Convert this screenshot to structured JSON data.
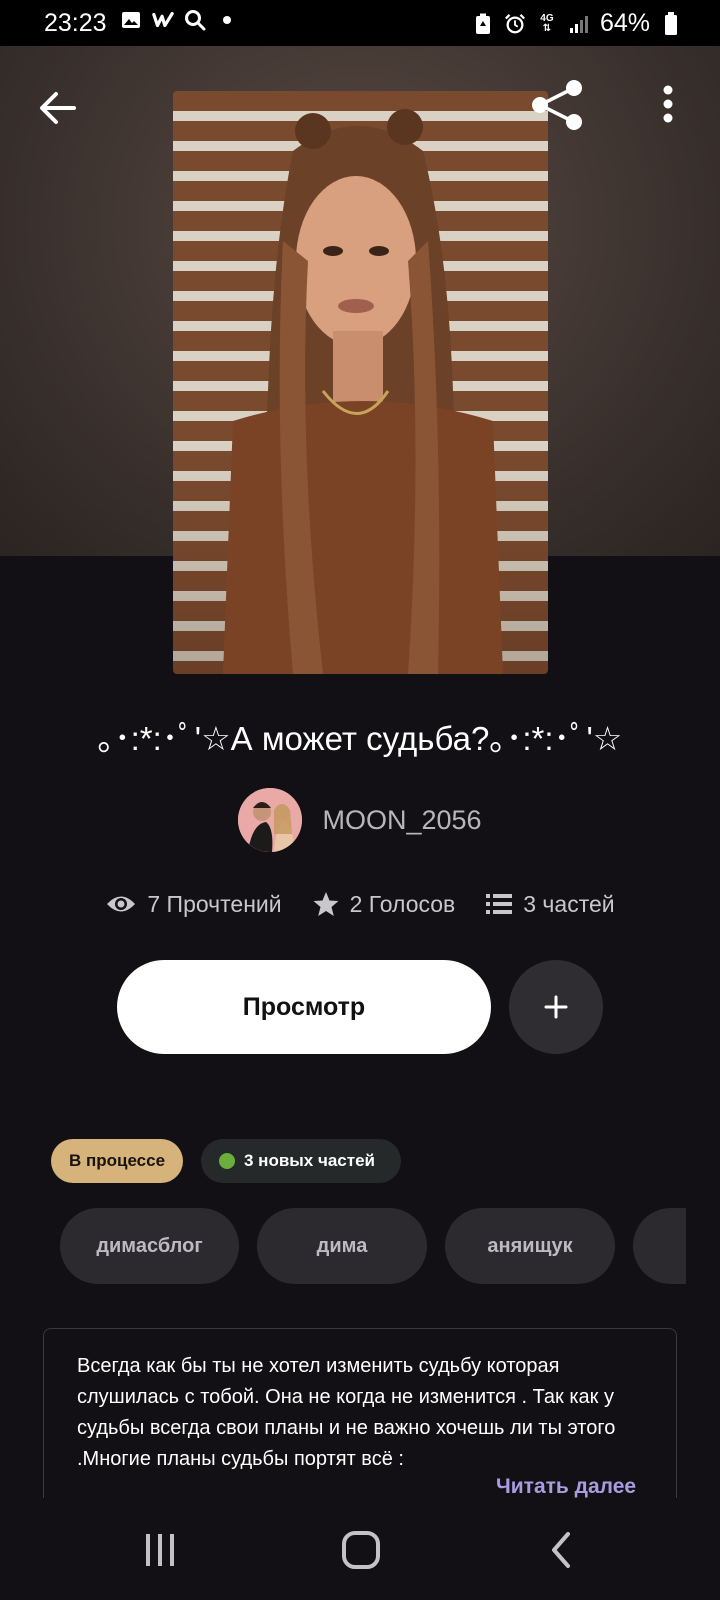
{
  "status_bar": {
    "time": "23:23",
    "battery": "64%",
    "left_icons": [
      "image-icon",
      "wattpad-w-icon",
      "search-icon",
      "dot-icon"
    ],
    "right_icons": [
      "battery-saver-icon",
      "alarm-icon",
      "4g-data-icon",
      "signal-icon",
      "battery-icon"
    ]
  },
  "header": {
    "back_icon": "arrow-left-icon",
    "share_icon": "share-icon",
    "more_icon": "more-vertical-icon"
  },
  "story": {
    "title": "｡･:*:･ﾟ'☆А может судьба?｡･:*:･ﾟ'☆",
    "author": "MOON_2056",
    "reads": "7 Прочтений",
    "votes": "2 Голосов",
    "parts": "3 частей"
  },
  "actions": {
    "view_label": "Просмотр",
    "add_label": "+"
  },
  "badges": {
    "status": "В процессе",
    "new_parts": "3 новых частей"
  },
  "tags": [
    "димасблог",
    "дима",
    "аняищук",
    ""
  ],
  "description": {
    "text": "Всегда как бы ты не хотел изменить судьбу которая слушилась с тобой. Она не когда не изменится . Так как у судьбы всегда свои планы и не важно хочешь ли ты этого .Многие планы судьбы портят всё :",
    "read_more": "Читать далее"
  },
  "colors": {
    "background": "#121014",
    "status_badge": "#d6b37a",
    "new_dot": "#6cae3e",
    "read_more": "#a99ce0"
  },
  "navbar": {
    "icons": [
      "recent-apps-icon",
      "home-icon",
      "back-icon"
    ]
  }
}
